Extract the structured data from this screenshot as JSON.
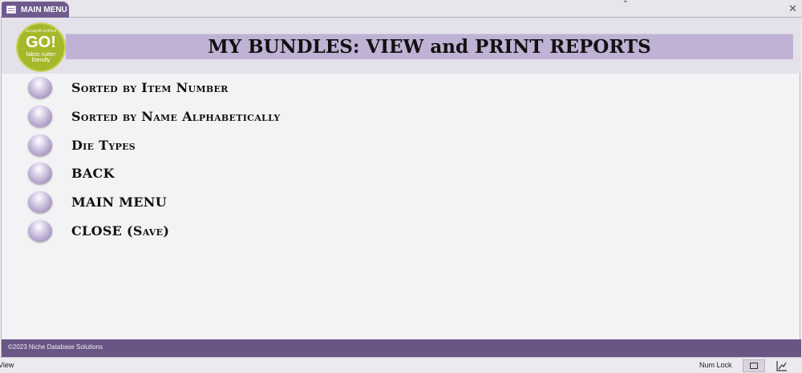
{
  "tab": {
    "label": "MAIN MENU"
  },
  "header": {
    "logo": {
      "arc_text": "accuquilt certified",
      "go": "GO!",
      "sub1": "fabric cutter",
      "sub2": "friendly"
    },
    "title": "MY BUNDLES: VIEW and PRINT REPORTS"
  },
  "menu": {
    "items": [
      {
        "label": "Sorted by Item Number"
      },
      {
        "label": "Sorted by Name Alphabetically"
      },
      {
        "label": "Die Types"
      },
      {
        "label": "BACK"
      },
      {
        "label": "MAIN MENU"
      },
      {
        "label": "CLOSE (Save)"
      }
    ]
  },
  "footer": {
    "copyright": "©2023 Niche Database Solutions"
  },
  "status": {
    "left": "View",
    "num_lock": "Num Lock"
  },
  "colors": {
    "accent": "#6a5684",
    "title_band": "#c0b2d4",
    "logo": "#a6b82a"
  }
}
